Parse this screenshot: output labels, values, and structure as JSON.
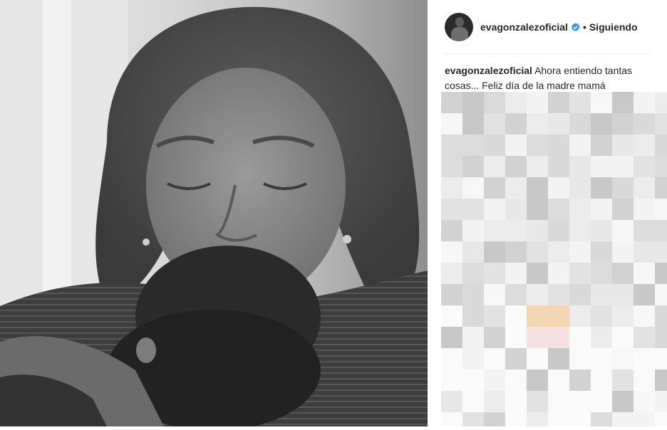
{
  "post": {
    "username": "evagonzalezoficial",
    "verified_icon": "verified-badge-icon",
    "separator": "•",
    "follow_status": "Siguiendo",
    "caption_user": "evagonzalezoficial",
    "caption_text": "Ahora entiendo tantas cosas... Feliz día de la madre mamá"
  },
  "colors": {
    "text": "#262626",
    "verified": "#3897f0",
    "divider": "#efefef"
  }
}
